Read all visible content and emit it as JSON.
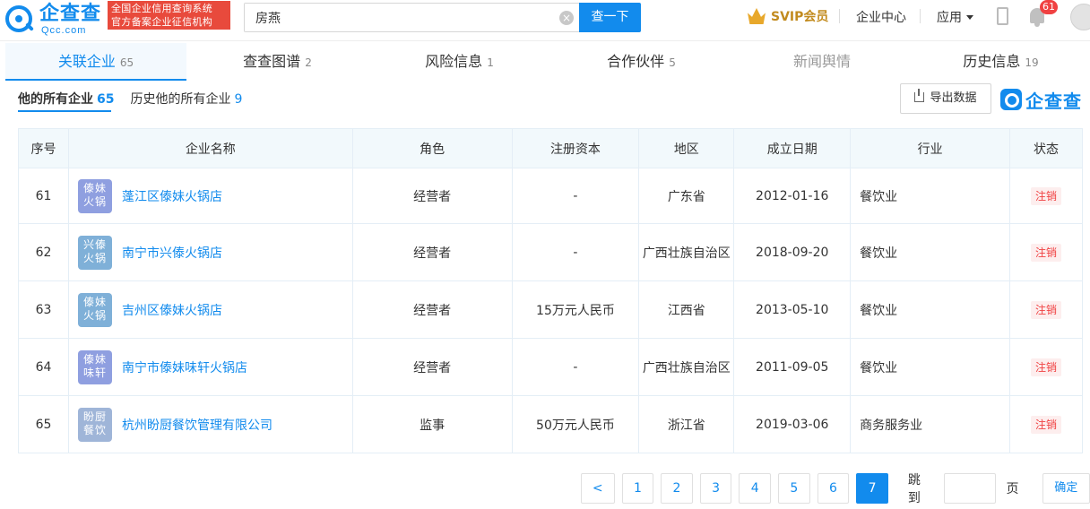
{
  "header": {
    "logo_text": "企查查",
    "logo_sub": "Qcc.com",
    "cert_line1": "全国企业信用查询系统",
    "cert_line2": "官方备案企业征信机构",
    "search_value": "房燕",
    "search_button": "查一下",
    "svip_label": "SVIP会员",
    "enterprise_center": "企业中心",
    "apps_label": "应用",
    "notification_count": "61"
  },
  "tabs": [
    {
      "label": "关联企业",
      "count": "65"
    },
    {
      "label": "查查图谱",
      "count": "2"
    },
    {
      "label": "风险信息",
      "count": "1"
    },
    {
      "label": "合作伙伴",
      "count": "5"
    },
    {
      "label": "新闻舆情",
      "count": ""
    },
    {
      "label": "历史信息",
      "count": "19"
    }
  ],
  "subtabs": [
    {
      "label": "他的所有企业",
      "count": "65"
    },
    {
      "label": "历史他的所有企业",
      "count": "9"
    }
  ],
  "toolbar": {
    "export_label": "导出数据",
    "brand_text": "企查查"
  },
  "table": {
    "headers": [
      "序号",
      "企业名称",
      "角色",
      "注册资本",
      "地区",
      "成立日期",
      "行业",
      "状态"
    ],
    "rows": [
      {
        "no": "61",
        "logo_l1": "傣妹",
        "logo_l2": "火锅",
        "logo_color": "#8f9fe0",
        "name": "蓬江区傣妹火锅店",
        "role": "经营者",
        "capital": "-",
        "region": "广东省",
        "date": "2012-01-16",
        "industry": "餐饮业",
        "status": "注销"
      },
      {
        "no": "62",
        "logo_l1": "兴傣",
        "logo_l2": "火锅",
        "logo_color": "#7fb0d8",
        "name": "南宁市兴傣火锅店",
        "role": "经营者",
        "capital": "-",
        "region": "广西壮族自治区",
        "date": "2018-09-20",
        "industry": "餐饮业",
        "status": "注销"
      },
      {
        "no": "63",
        "logo_l1": "傣妹",
        "logo_l2": "火锅",
        "logo_color": "#7fb0d8",
        "name": "吉州区傣妹火锅店",
        "role": "经营者",
        "capital": "15万元人民币",
        "region": "江西省",
        "date": "2013-05-10",
        "industry": "餐饮业",
        "status": "注销"
      },
      {
        "no": "64",
        "logo_l1": "傣妹",
        "logo_l2": "味轩",
        "logo_color": "#8f9fe0",
        "name": "南宁市傣妹味轩火锅店",
        "role": "经营者",
        "capital": "-",
        "region": "广西壮族自治区",
        "date": "2011-09-05",
        "industry": "餐饮业",
        "status": "注销"
      },
      {
        "no": "65",
        "logo_l1": "盼厨",
        "logo_l2": "餐饮",
        "logo_color": "#9fb5d8",
        "name": "杭州盼厨餐饮管理有限公司",
        "role": "监事",
        "capital": "50万元人民币",
        "region": "浙江省",
        "date": "2019-03-06",
        "industry": "商务服务业",
        "status": "注销"
      }
    ]
  },
  "pagination": {
    "prev_label": "<",
    "pages": [
      "1",
      "2",
      "3",
      "4",
      "5",
      "6",
      "7"
    ],
    "active_page": "7",
    "jump_label": "跳到",
    "page_unit": "页",
    "confirm_label": "确定"
  },
  "colors": {
    "accent": "#128bed",
    "status_red": "#f04142",
    "cert_red": "#e84a3c",
    "svip_gold": "#c28b1e"
  }
}
